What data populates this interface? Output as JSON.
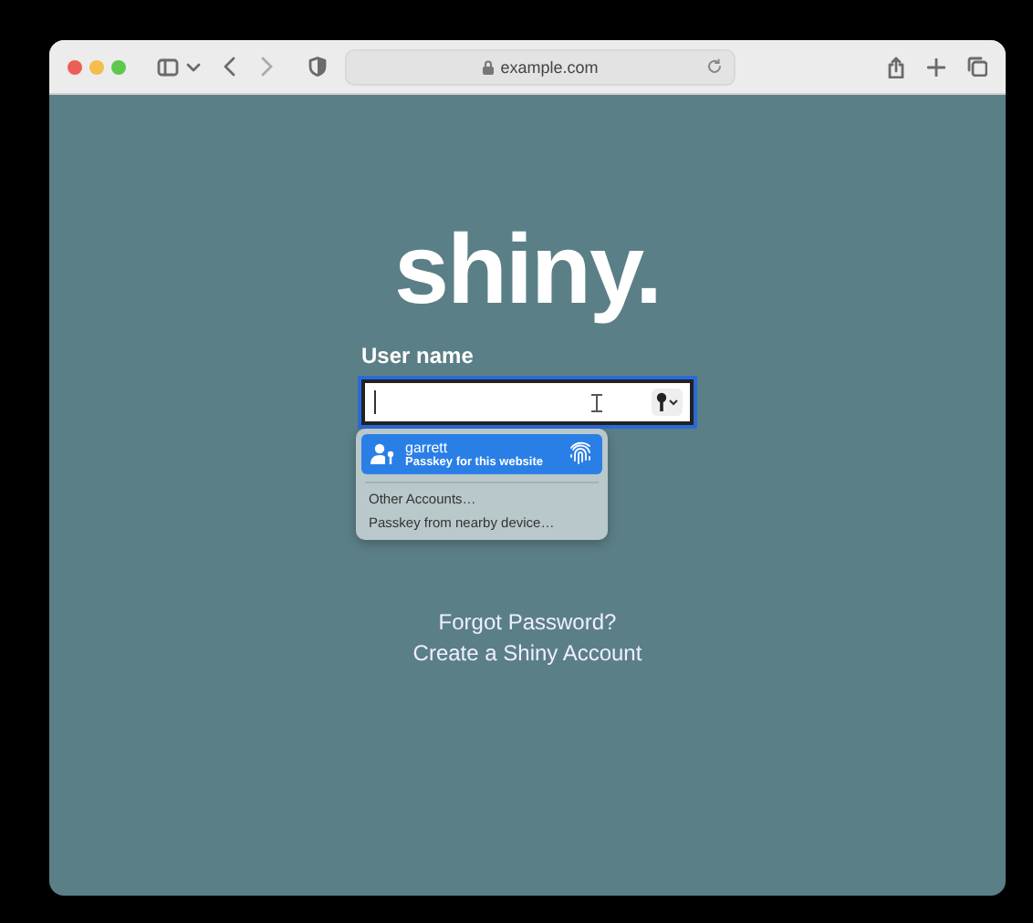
{
  "browser": {
    "url": "example.com"
  },
  "page": {
    "logo": "shiny.",
    "username_label": "User name",
    "username_field": {
      "focused": true
    },
    "autofill_menu": {
      "items": [
        {
          "kind": "passkey",
          "title": "garrett",
          "subtitle": "Passkey for this website",
          "selected": true
        },
        {
          "kind": "option",
          "title": "Other Accounts…",
          "selected": false
        },
        {
          "kind": "option",
          "title": "Passkey from nearby device…",
          "selected": false
        }
      ]
    },
    "links": [
      "Forgot Password?",
      "Create a Shiny Account"
    ]
  }
}
